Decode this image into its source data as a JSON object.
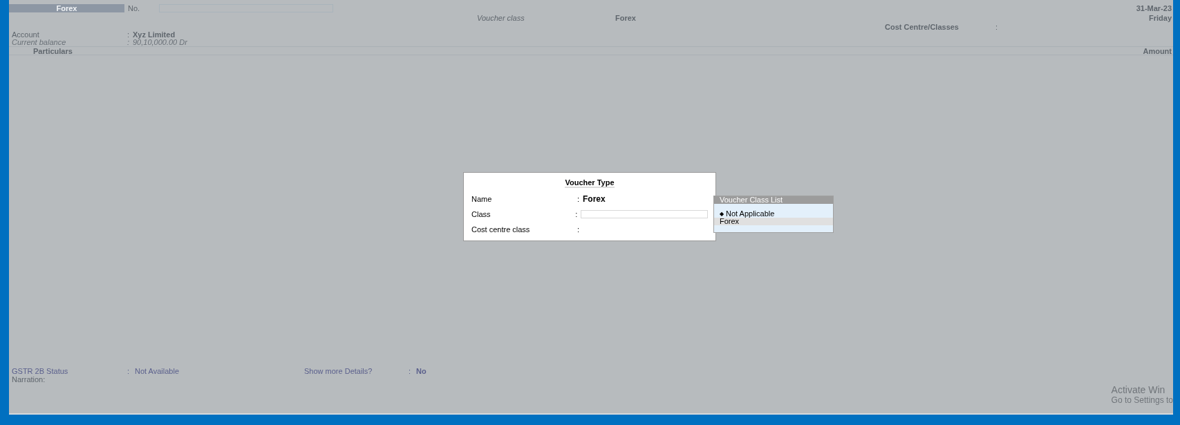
{
  "voucher": {
    "type_label": "Forex",
    "number_label": "No.",
    "class_label": "Voucher class",
    "class_value": "Forex",
    "date": "31-Mar-23",
    "day": "Friday",
    "cost_centre_label": "Cost Centre/Classes",
    "cost_centre_sep": ":"
  },
  "account": {
    "label": "Account",
    "sep": ":",
    "value": "Xyz Limited"
  },
  "balance": {
    "label": "Current balance",
    "sep": ":",
    "value": "90,10,000.00 Dr"
  },
  "columns": [
    "Particulars",
    "Amount"
  ],
  "footer_fields": [
    {
      "label": "GSTR 2B Status",
      "sep": ":",
      "value": "Not Available"
    },
    {
      "label": "Show more Details?",
      "sep": ":",
      "value": "No"
    }
  ],
  "narration_label": "Narration:",
  "dialog": {
    "title": "Voucher Type",
    "rows": [
      {
        "kind": "text",
        "label": "Name",
        "sep": ":",
        "value": "Forex"
      },
      {
        "kind": "field",
        "label": "Class",
        "sep": ":"
      },
      {
        "kind": "text",
        "label": "Cost centre class",
        "sep": ":"
      }
    ]
  },
  "list": {
    "title": "Voucher Class List",
    "items": [
      {
        "label": "Not Applicable",
        "marker": "◆",
        "selected": false
      },
      {
        "label": "Forex",
        "selected": true
      }
    ]
  },
  "activation_notice": [
    "Activate Win",
    "Go to Settings to"
  ]
}
